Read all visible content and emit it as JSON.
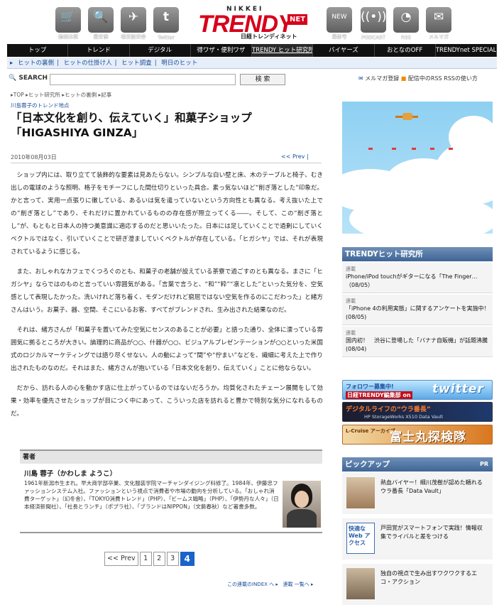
{
  "header": {
    "icons": [
      {
        "label": "価格比較",
        "icon": "cart-icon"
      },
      {
        "label": "最安値",
        "icon": "search-icon"
      },
      {
        "label": "格安航空券",
        "icon": "airplane-icon"
      },
      {
        "label": "Twitter",
        "icon": "twitter-icon"
      },
      {
        "label": "最新号",
        "icon": "new-issue-icon"
      },
      {
        "label": "PODCAST",
        "icon": "podcast-icon"
      },
      {
        "label": "RSS",
        "icon": "rss-icon"
      },
      {
        "label": "メルマガ",
        "icon": "mail-icon"
      }
    ],
    "logo": {
      "top": "NIKKEI",
      "main": "TRENDY",
      "net": "NET",
      "sub": "日経トレンディネット"
    }
  },
  "global_nav": [
    "トップ",
    "トレンド",
    "デジタル",
    "得ワザ・便利ワザ",
    "TRENDY ヒット研究所",
    "バイヤーズ",
    "おとなのOFF",
    "TRENDYnet SPECIAL"
  ],
  "sub_nav": [
    "ヒットの裏側",
    "ヒットの仕掛け人",
    "ヒット調査",
    "明日のヒット"
  ],
  "search": {
    "label": "SEARCH",
    "button": "検 索",
    "value": ""
  },
  "top_links": {
    "mailmag": "メルマガ登録",
    "rss": "配信中のRSS",
    "rss_howto": "RSSの使い方"
  },
  "breadcrumb": "▸TOP ▸ヒット研究所 ▸ヒットの裏側 ▸記事",
  "section": "川島蓉子のトレンド地点",
  "article": {
    "title_line1": "「日本文化を創り、伝えていく」和菓子ショップ",
    "title_line2": "「HIGASHIYA GINZA」",
    "date": "2010年08月03日",
    "prev": "<< Prev |",
    "paragraphs": [
      "ショップ内には、取り立てて装飾的な要素は見あたらない。シンプルな白い壁と床、木のテーブルと椅子、むき出しの電球のような照明、格子をモチーフにした間仕切りといった具合。素っ気ないほど“削ぎ落とした”印象だ。かと言って、実用一点張りに徹している、あるいは気を遣っていないという方向性とも異なる。考え抜いた上での“削ぎ落とし”であり、それだけに置かれているものの存在感が際立ってくる――。そして、この“削ぎ落とし”が、もともと日本人の持つ美意識に適応するのだと思いいたった。日本には足していくことで過剰にしていくベクトルではなく、引いていくことで研ぎ澄ましていくベクトルが存在している。「ヒガシヤ」では、それが表現されているように感じる。",
      "また、おしゃれなカフェでくつろぐのとも、和菓子の老舗が設えている茶寮で過ごすのとも異なる。まさに「ヒガシヤ」ならではのものと言っていい雰囲気がある。「言葉で言うと、“和”“粋”“凛とした”といった気分を、空気感として表現したかった。洗いけれど落ち着く、モダンだけれど窮屈ではない空気を作るのにこだわった」と緒方さんはいう。お菓子、器、空間、そこにいるお客、すべてがブレンドされ、生み出された結果なのだ。",
      "それは、緒方さんが「和菓子を置いてみた空気にセンスのあることが必要」と語った通り、全体に漂っている雰囲気に拠るところが大きい。論理的に商品が○○、什器が○○、ビジュアルプレゼンテーションが○○といった米国式のロジカルマーケティングでは語り尽くせない。人の動によって“間”や“佇まい”などを、繊細に考えた上で作り出されたものなのだ。それはまた、緒方さんが抱いている「日本文化を創り、伝えていく」ことに他ならない。",
      "だから、訪れる人の心を動かす店に仕上がっているのではないだろうか。均質化されたチェーン展開をして効果・効率を優先させたショップが目につく中にあって、こういった店を訪れると豊かで特別な気分になれるものだ。"
    ]
  },
  "author": {
    "heading": "著者",
    "name": "川島 蓉子（かわしま ようこ）",
    "bio": "1961年新潟市生まれ。早大商学部卒業、文化服装学院マーチャンダイジング科修了。1984年、伊藤忠ファッションシステム入社。ファッションという視点で消費者や市場の動向を分析している。「おしゃれ消費ターゲット」（幻冬舎）、「TOKYO消費トレンド」（PHP）、「ビームス戦略」（PHP）、「伊勢丹な人々」（日本経済新聞社）、「社長とランチ」（ポプラ社）、「ブランドはNIPPON」（文藝春秋）など著書多数。"
  },
  "pager": {
    "prev": "<< Prev",
    "pages": [
      "1",
      "2",
      "3"
    ],
    "current": "4"
  },
  "footer": {
    "index": "この連載のINDEX へ ▸",
    "list": "連載 一覧へ ▸"
  },
  "sidebar": {
    "hit_lab": {
      "heading": "TRENDYヒット研究所",
      "items": [
        {
          "cat": "連載",
          "text": "iPhone/iPod touchがギターになる「The Finger…（08/05）"
        },
        {
          "cat": "連載",
          "text": "「iPhone 4の利用実態」に関するアンケートを実施中！ (08/05)"
        },
        {
          "cat": "連載",
          "text": "国内初！　渋谷に登場した「バナナ自販機」が話題沸騰 (08/04)"
        }
      ]
    },
    "banners": {
      "twitter": {
        "line1": "フォロワー募集中!",
        "line2": "日経TRENDY編集部 on",
        "brand": "twitter"
      },
      "data_vault": {
        "title": "デジタルライフの“ウラ番長”",
        "sub": "HP StorageWorks X510 Data Vault"
      },
      "fujimaru": {
        "small": "L-Cruise アーカイブ",
        "big": "富士丸探検隊"
      }
    },
    "pickup": {
      "heading": "ピックアップ",
      "pr": "PR",
      "items": [
        {
          "text": "熱血バイヤー！細川茂樹が認めた頼れるウラ番長「Data Vault」"
        },
        {
          "thumb": "快適な Web アクセス",
          "text": "戸田覚がスマートフォンで実践！情報収集でライバルと差をつける"
        },
        {
          "text": "独自の視点で生み出すワクワクするエコ・アクション"
        }
      ]
    }
  }
}
